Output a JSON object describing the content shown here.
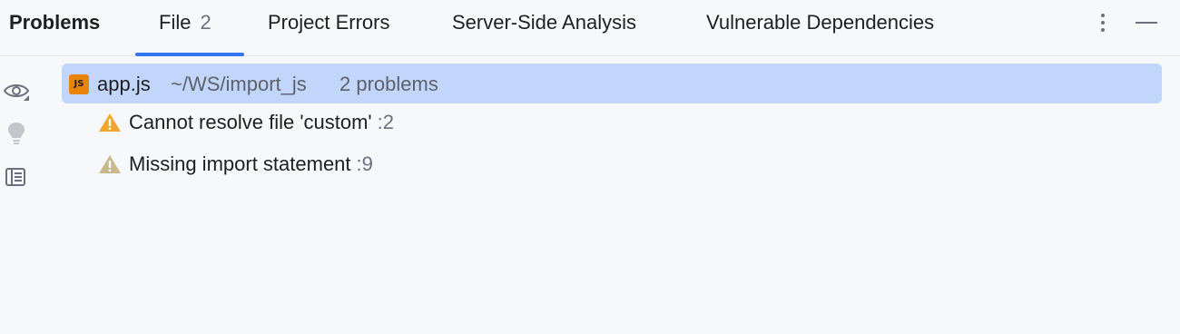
{
  "panel": {
    "title": "Problems"
  },
  "tabs": [
    {
      "label": "File",
      "count": "2",
      "active": true
    },
    {
      "label": "Project Errors"
    },
    {
      "label": "Server-Side Analysis"
    },
    {
      "label": "Vulnerable Dependencies"
    }
  ],
  "header_icons": [
    "more-vertical-icon",
    "minimize-icon"
  ],
  "gutter_icons": [
    "eye-icon",
    "lightbulb-icon",
    "preview-icon"
  ],
  "file": {
    "icon_text": "JS",
    "name": "app.js",
    "path": "~/WS/import_js",
    "problem_count": "2 problems"
  },
  "problems": [
    {
      "text": "Cannot resolve file 'custom'",
      "line": ":2",
      "severity": "warning"
    },
    {
      "text": "Missing import statement",
      "line": ":9",
      "severity": "weak-warning"
    }
  ],
  "colors": {
    "accent": "#3574f0",
    "selection": "#c2d6fc",
    "warning": "#f2a62f",
    "weak_warning": "#c8b98c",
    "js_badge": "#e8830b"
  }
}
